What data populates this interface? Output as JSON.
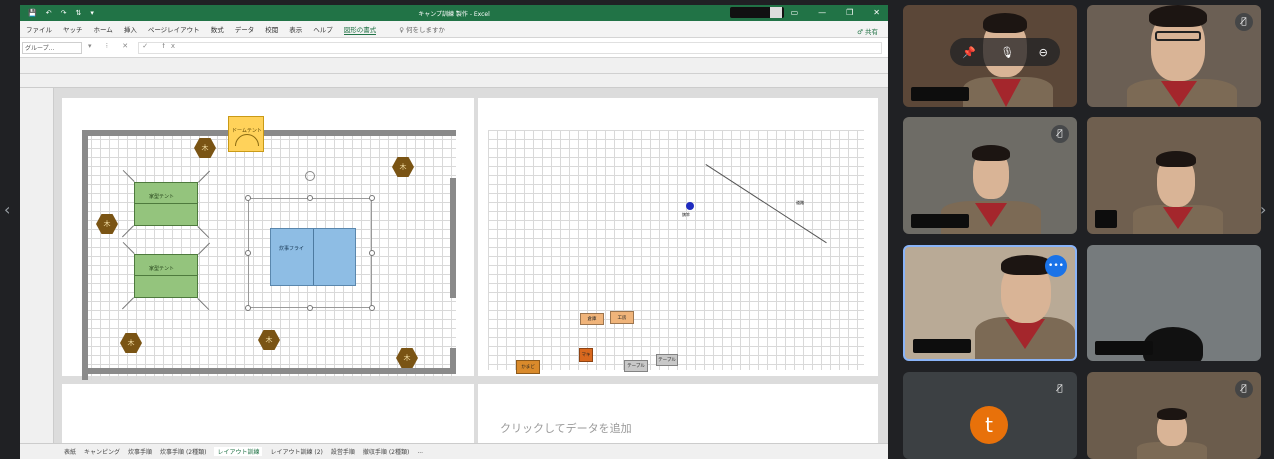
{
  "excel": {
    "window_title": "キャンプ訓練 製作 - Excel",
    "qat": [
      "💾",
      "↶",
      "↷",
      "⇅",
      "▾"
    ],
    "window_controls": [
      "▭",
      "—",
      "❐",
      "✕"
    ],
    "ribbon_tabs": [
      "ファイル",
      "ヤッチ",
      "ホーム",
      "挿入",
      "ページレイアウト",
      "数式",
      "データ",
      "校閲",
      "表示",
      "ヘルプ",
      "図形の書式"
    ],
    "active_tab_index": 10,
    "tell_me": "♀ 何をしますか",
    "share": "♂ 共有",
    "name_box": "グループ...",
    "fx_icons": "▾ ⁝ ✕ ✓ fx",
    "add_data": "クリックしてデータを追加",
    "left_layout": {
      "dome_label": "ドームテント",
      "fly_label": "炊事フライ",
      "tent_label": "家型テント",
      "tree_glyph": "木"
    },
    "right_layout": {
      "marker_label": "旗竿",
      "line_label": "道路",
      "boxes": [
        {
          "label": "倉庫",
          "color": "#f0b47a"
        },
        {
          "label": "工房",
          "color": "#f0b47a"
        },
        {
          "label": "かまど",
          "color": "#d98a2b"
        },
        {
          "label": "テーブル",
          "color": "#c8c8c8"
        },
        {
          "label": "テーブル",
          "color": "#c8c8c8"
        },
        {
          "label": "マキ",
          "color": "#d9681e"
        }
      ]
    },
    "sheet_tabs": [
      "表紙",
      "キャンピング",
      "炊事手順",
      "炊事手順 (2種類)",
      "レイアウト訓練",
      "レイアウト訓練 (2)",
      "設営手順",
      "撤収手順 (2種類)",
      "..."
    ],
    "active_sheet_index": 4
  },
  "meet": {
    "hover_controls": [
      "📌",
      "🎙",
      "⊖"
    ],
    "more_icon": "•••",
    "avatar_letter": "t",
    "accent": "#1a73e8",
    "avatar_color": "#e8710a",
    "muted_glyph": "🎙̸"
  }
}
